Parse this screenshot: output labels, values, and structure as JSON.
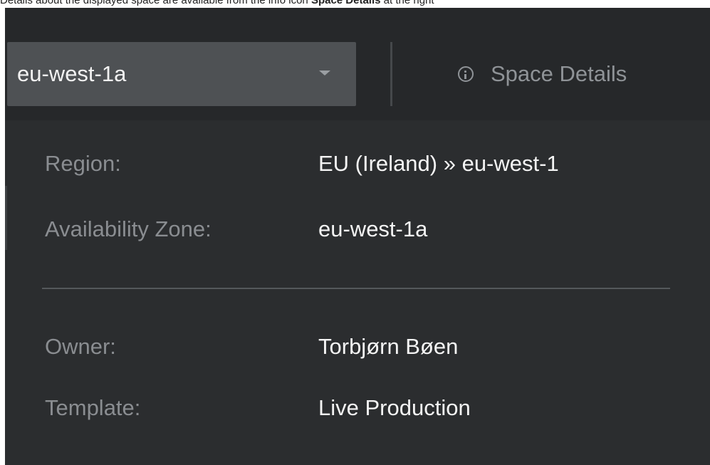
{
  "caption": {
    "text": "Details about the displayed space are available from the info icon",
    "bold": "Space Details",
    "tail": "at the right"
  },
  "toolbar": {
    "zone_select_value": "eu-west-1a",
    "space_details_label": "Space Details"
  },
  "details": {
    "region": {
      "label": "Region:",
      "value": "EU (Ireland) » eu-west-1"
    },
    "availability_zone": {
      "label": "Availability Zone:",
      "value": "eu-west-1a"
    },
    "owner": {
      "label": "Owner:",
      "value": "Torbjørn Bøen"
    },
    "template": {
      "label": "Template:",
      "value": "Live Production"
    }
  },
  "colors": {
    "panel_bg": "#2b2d2f",
    "select_bg": "#4e5154",
    "label_text": "#8a8d91",
    "value_text": "#f4f4f4"
  }
}
